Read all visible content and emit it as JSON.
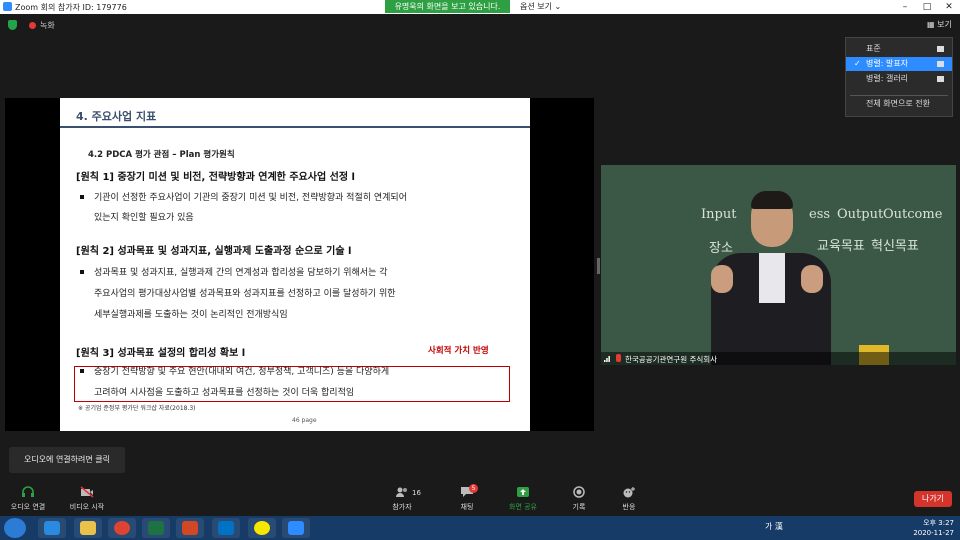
{
  "window": {
    "title": "Zoom 회의 참가자 ID: 179776",
    "controls": [
      "–",
      "□",
      "✕"
    ]
  },
  "share_banner": "유명욱의 화면을 보고 있습니다.",
  "view_options_label": "옵션 보기",
  "recording_label": "녹화",
  "view_button_label": "보기",
  "view_menu": {
    "items": [
      {
        "label": "표준",
        "selected": false
      },
      {
        "label": "병렬: 발표자",
        "selected": true
      },
      {
        "label": "병렬: 갤러리",
        "selected": false
      },
      {
        "label": "전체 화면으로 전환",
        "selected": false
      }
    ],
    "check": "✓"
  },
  "slide": {
    "header": "4. 주요사업 지표",
    "subheader": "4.2 PDCA 평가 관점 – Plan 평가원칙",
    "principle1": "[원칙 1] 중장기 미션 및 비전, 전략방향과 연계한 주요사업 선정 l",
    "bullet1_line1": "기관이 선정한 주요사업이 기관의 중장기 미션 및 비전, 전략방향과 적절히 연계되어",
    "bullet1_line2": "있는지 확인할 필요가 있음",
    "principle2": "[원칙 2] 성과목표 및 성과지표, 실행과제 도출과정 순으로 기술 l",
    "bullet2_line1": "성과목표 및 성과지표, 실행과제 간의 연계성과 합리성을 담보하기 위해서는 각",
    "bullet2_line2": "주요사업의 평가대상사업별 성과목표와 성과지표를 선정하고 이를 달성하기 위한",
    "bullet2_line3": "세부실행과제를 도출하는 것이 논리적인 전개방식임",
    "principle3": "[원칙 3] 성과목표 설정의 합리성 확보 l",
    "red_note": "사회적 가치 반영",
    "bullet3_line1": "중장기 전략방향 및 주요 현안(대내외 여건, 정부정책, 고객니즈) 등을 다양하게",
    "bullet3_line2": "고려하여 시사점을 도출하고 성과목표를 선정하는 것이 더욱 합리적임",
    "source": "※ 공기업 준정부 평가단 워크샵 자료(2018.3)",
    "page": "46 page"
  },
  "video": {
    "participant_name": "한국공공기관연구원 주식회사",
    "chalk": [
      "Input",
      "ess",
      "Output",
      "Outcome",
      "장소",
      "교육목표",
      "혁신목표"
    ]
  },
  "audio_prompt": "오디오에 연결하려면 클릭",
  "toolbar": {
    "audio": "오디오 연결",
    "video": "비디오 시작",
    "participants": "참가자",
    "participants_count": "16",
    "chat": "채팅",
    "chat_badge": "5",
    "share": "화면 공유",
    "record": "기록",
    "reactions": "반응",
    "leave": "나가기"
  },
  "taskbar": {
    "ime": "가 漢",
    "time": "오후 3:27",
    "date": "2020-11-27"
  },
  "colors": {
    "share_banner": "#2ea043",
    "selected": "#2d8cff",
    "leave": "#d4342c",
    "slide_accent": "#3b4f6e",
    "red_note": "#c00000"
  }
}
